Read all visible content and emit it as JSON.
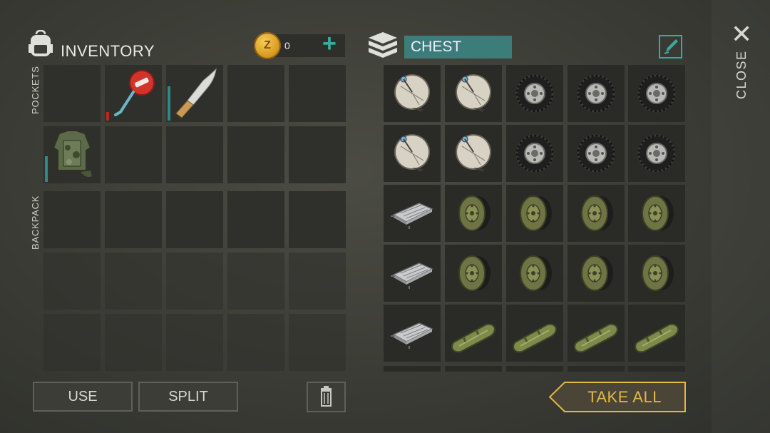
{
  "inventory": {
    "title": "INVENTORY",
    "coins": "0",
    "coin_letter": "Z",
    "pockets_label": "POCKETS",
    "backpack_label": "BACKPACK"
  },
  "chest": {
    "title": "CHEST"
  },
  "buttons": {
    "use": "USE",
    "split": "SPLIT",
    "take_all": "TAKE ALL",
    "close": "CLOSE"
  },
  "colors": {
    "accent": "#3aa9a0",
    "chest_header": "#3c7d79",
    "take_all": "#e2b84a"
  },
  "pocket_items": [
    "stop-sign-icon",
    "machete-icon",
    "",
    "",
    "",
    "armor-vest-icon",
    "",
    "",
    "",
    ""
  ],
  "chest_items": [
    [
      "satellite-dish-icon",
      "satellite-dish-icon",
      "tire-icon",
      "tire-icon",
      "tire-icon"
    ],
    [
      "satellite-dish-icon",
      "satellite-dish-icon",
      "tire-icon",
      "tire-icon",
      "tire-icon"
    ],
    [
      "circuit-board-icon",
      "green-wheel-icon",
      "green-wheel-icon",
      "green-wheel-icon",
      "green-wheel-icon"
    ],
    [
      "circuit-board-icon",
      "green-wheel-icon",
      "green-wheel-icon",
      "green-wheel-icon",
      "green-wheel-icon"
    ],
    [
      "circuit-board-icon",
      "fuel-tank-icon",
      "fuel-tank-icon",
      "fuel-tank-icon",
      "fuel-tank-icon"
    ]
  ]
}
